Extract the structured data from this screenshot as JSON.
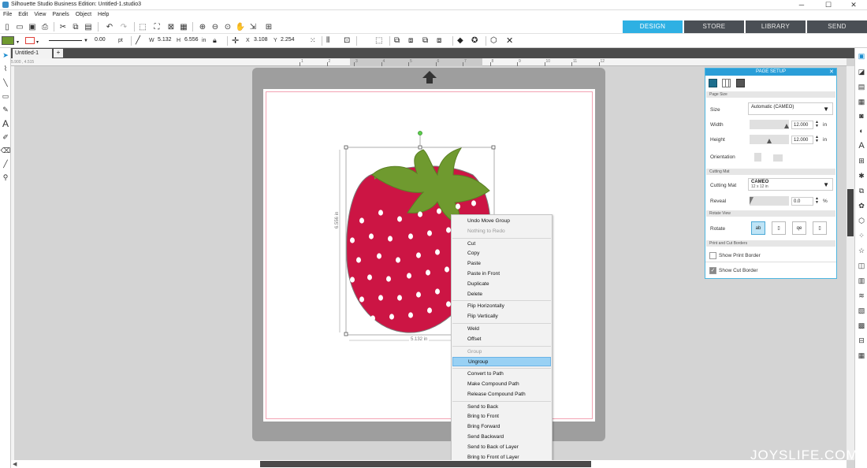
{
  "window": {
    "title": "Silhouette Studio Business Edition: Untitled-1.studio3"
  },
  "menu": [
    "File",
    "Edit",
    "View",
    "Panels",
    "Object",
    "Help"
  ],
  "nav_tabs": [
    {
      "label": "DESIGN",
      "active": true
    },
    {
      "label": "STORE"
    },
    {
      "label": "LIBRARY"
    },
    {
      "label": "SEND"
    }
  ],
  "props": {
    "stroke_width": "0.00",
    "stroke_unit": "pt",
    "w_label": "W",
    "w": "5.132",
    "h_label": "H",
    "h": "6.556",
    "size_unit": "in",
    "x_label": "X",
    "x": "3.108",
    "y_label": "Y",
    "y": "2.254"
  },
  "doc_tab": {
    "label": "Untitled-1",
    "add": "+"
  },
  "ruler": {
    "coords": "5.900 , 4.515",
    "ticks": [
      "1",
      "2",
      "3",
      "4",
      "5",
      "6",
      "7",
      "8",
      "9",
      "10",
      "11",
      "12"
    ]
  },
  "selection": {
    "width_label": "5.132 in",
    "height_label": "6.556 in"
  },
  "page_setup": {
    "title": "PAGE SETUP",
    "sec_page_size": "Page Size",
    "size_label": "Size",
    "size_value": "Automatic (CAMEO)",
    "width_label": "Width",
    "width_value": "12.000",
    "width_unit": "in",
    "height_label": "Height",
    "height_value": "12.000",
    "height_unit": "in",
    "orientation_label": "Orientation",
    "sec_cutting_mat": "Cutting Mat",
    "mat_label": "Cutting Mat",
    "mat_value": "CAMEO",
    "mat_sub": "12 x 12 in",
    "reveal_label": "Reveal",
    "reveal_value": "0.0",
    "reveal_unit": "%",
    "sec_rotate": "Rotate View",
    "rotate_label": "Rotate",
    "sec_borders": "Print and Cut Borders",
    "print_border": "Show Print Border",
    "cut_border": "Show Cut Border"
  },
  "context_menu": [
    {
      "label": "Undo Move Group"
    },
    {
      "label": "Nothing to Redo",
      "disabled": true
    },
    {
      "sep": true
    },
    {
      "label": "Cut"
    },
    {
      "label": "Copy"
    },
    {
      "label": "Paste"
    },
    {
      "label": "Paste in Front"
    },
    {
      "label": "Duplicate"
    },
    {
      "label": "Delete"
    },
    {
      "sep": true
    },
    {
      "label": "Flip Horizontally"
    },
    {
      "label": "Flip Vertically"
    },
    {
      "sep": true
    },
    {
      "label": "Weld"
    },
    {
      "label": "Offset"
    },
    {
      "sep": true
    },
    {
      "label": "Group",
      "disabled": true
    },
    {
      "label": "Ungroup",
      "highlighted": true
    },
    {
      "sep": true
    },
    {
      "label": "Convert to Path"
    },
    {
      "label": "Make Compound Path"
    },
    {
      "label": "Release Compound Path"
    },
    {
      "sep": true
    },
    {
      "label": "Send to Back"
    },
    {
      "label": "Bring to Front"
    },
    {
      "label": "Bring Forward"
    },
    {
      "label": "Send Backward"
    },
    {
      "label": "Send to Back of Layer"
    },
    {
      "label": "Bring to Front of Layer"
    }
  ],
  "watermark": "JOYSLIFE.COM",
  "colors": {
    "accent": "#2eb0e3",
    "strawberry": "#cc1544",
    "leaves": "#6f9a2f",
    "fill_swatch": "#6f9a2f",
    "line_swatch": "#e0413a"
  }
}
